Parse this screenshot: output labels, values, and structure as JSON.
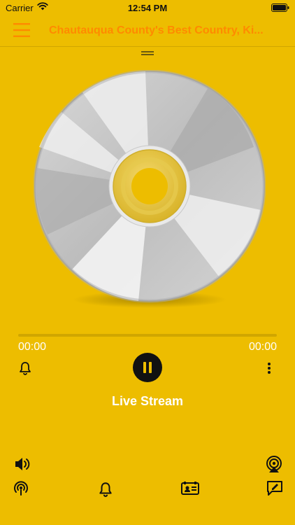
{
  "status_bar": {
    "carrier": "Carrier",
    "time": "12:54 PM"
  },
  "header": {
    "title": "Chautauqua County's Best Country, Ki..."
  },
  "player": {
    "elapsed": "00:00",
    "duration": "00:00",
    "progress": 0,
    "stream_title": "Live Stream"
  },
  "icons": {
    "menu": "hamburger-menu-icon",
    "drag": "drag-handle-icon",
    "alarm": "bell-icon",
    "pause": "pause-icon",
    "more": "more-vertical-icon",
    "volume": "speaker-icon",
    "airplay": "airplay-icon",
    "podcast": "podcast-icon",
    "alarm_tab": "bell-icon",
    "contact": "contact-card-icon",
    "compose": "compose-icon"
  },
  "colors": {
    "background": "#EDBD00",
    "accent": "#FF8A00",
    "text": "#FFFFFF",
    "icon": "#111111"
  }
}
